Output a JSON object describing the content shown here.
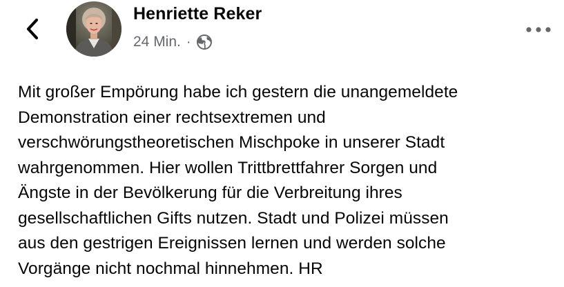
{
  "post": {
    "author_name": "Henriette Reker",
    "timestamp": "24 Min.",
    "separator": "·",
    "privacy_icon": "globe-icon",
    "text": "Mit großer Empörung habe ich gestern die unangemeldete\nDemonstration einer rechtsextremen und\nverschwörungstheoretischen Mischpoke in unserer Stadt\nwahrgenommen. Hier wollen Trittbrettfahrer Sorgen und\nÄngste in der Bevölkerung für die Verbreitung ihres\ngesellschaftlichen Gifts nutzen. Stadt und Polizei müssen\naus den gestrigen Ereignissen lernen und werden solche\nVorgänge nicht nochmal hinnehmen. HR"
  },
  "header": {
    "back_icon": "chevron-left-icon",
    "more_icon": "more-horizontal-icon"
  },
  "colors": {
    "text_primary": "#050505",
    "text_secondary": "#65676b",
    "icon_gray": "#65676b"
  }
}
